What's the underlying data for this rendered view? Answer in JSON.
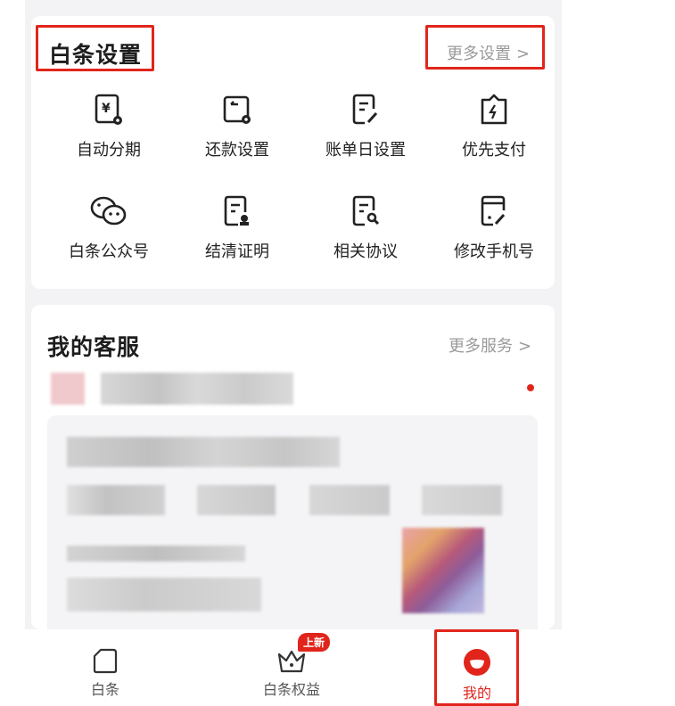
{
  "settings": {
    "title": "白条设置",
    "more_label": "更多设置",
    "items": [
      {
        "label": "自动分期",
        "icon": "yen-document-gear-icon"
      },
      {
        "label": "还款设置",
        "icon": "repayment-settings-icon"
      },
      {
        "label": "账单日设置",
        "icon": "bill-edit-icon"
      },
      {
        "label": "优先支付",
        "icon": "priority-payment-icon"
      },
      {
        "label": "白条公众号",
        "icon": "wechat-icon"
      },
      {
        "label": "结清证明",
        "icon": "settlement-certificate-icon"
      },
      {
        "label": "相关协议",
        "icon": "agreement-search-icon"
      },
      {
        "label": "修改手机号",
        "icon": "change-phone-icon"
      }
    ]
  },
  "service": {
    "title": "我的客服",
    "more_label": "更多服务"
  },
  "bottom_nav": {
    "items": [
      {
        "label": "白条",
        "icon": "card-icon"
      },
      {
        "label": "白条权益",
        "icon": "crown-icon",
        "badge": "上新"
      },
      {
        "label": "我的",
        "icon": "profile-icon",
        "active": true
      }
    ]
  },
  "colors": {
    "accent": "#e1251b",
    "muted_text": "#9a9a9a",
    "background": "#f3f3f5"
  }
}
